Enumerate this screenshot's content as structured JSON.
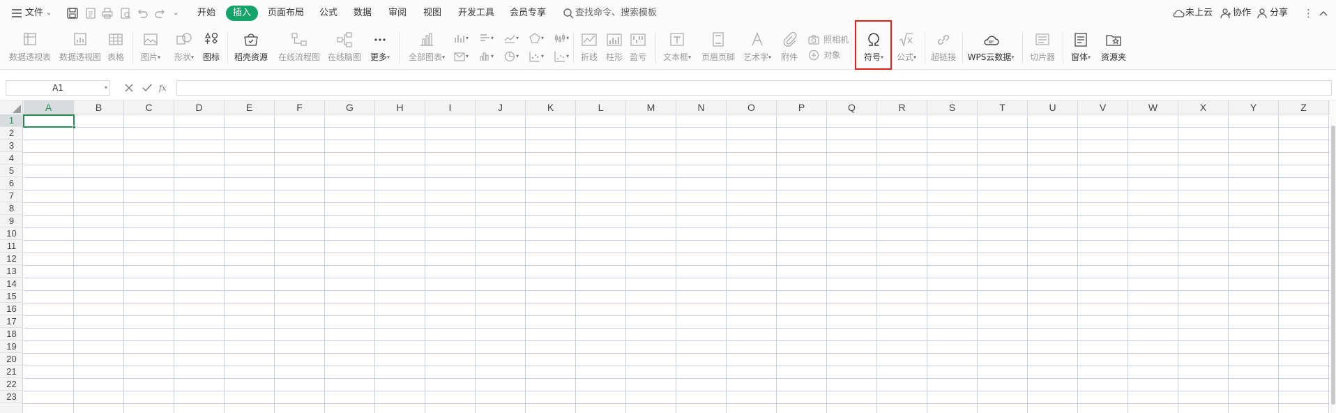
{
  "menubar": {
    "file_label": "文件",
    "tabs": [
      {
        "label": "开始"
      },
      {
        "label": "插入"
      },
      {
        "label": "页面布局"
      },
      {
        "label": "公式"
      },
      {
        "label": "数据"
      },
      {
        "label": "审阅"
      },
      {
        "label": "视图"
      },
      {
        "label": "开发工具"
      },
      {
        "label": "会员专享"
      }
    ],
    "active_tab": "插入",
    "search_placeholder": "查找命令、搜索模板",
    "cloud_label": "未上云",
    "collab_label": "协作",
    "share_label": "分享"
  },
  "ribbon": {
    "pivot_table": "数据透视表",
    "pivot_chart": "数据透视图",
    "table": "表格",
    "picture": "图片",
    "shape": "形状",
    "icon": "图标",
    "daoke": "稻壳资源",
    "flowchart": "在线流程图",
    "mindmap": "在线脑图",
    "more": "更多",
    "all_charts": "全部图表",
    "spark_line": "折线",
    "spark_column": "柱形",
    "spark_winloss": "盈亏",
    "textbox": "文本框",
    "header_footer": "页眉页脚",
    "wordart": "艺术字",
    "attachment": "附件",
    "camera": "照相机",
    "object": "对象",
    "symbol": "符号",
    "formula": "公式",
    "hyperlink": "超链接",
    "wps_cloud_data": "WPS云数据",
    "slicer": "切片器",
    "form": "窗体",
    "resource": "资源夹"
  },
  "formula_bar": {
    "name_box": "A1",
    "formula": ""
  },
  "sheet": {
    "columns": [
      "A",
      "B",
      "C",
      "D",
      "E",
      "F",
      "G",
      "H",
      "I",
      "J",
      "K",
      "L",
      "M",
      "N",
      "O",
      "P",
      "Q",
      "R",
      "S",
      "T",
      "U",
      "V",
      "W",
      "X",
      "Y",
      "Z"
    ],
    "rows": [
      "1",
      "2",
      "3",
      "4",
      "5",
      "6",
      "7",
      "8",
      "9",
      "10",
      "11",
      "12",
      "13",
      "14",
      "15",
      "16",
      "17",
      "18",
      "19",
      "20",
      "21",
      "22",
      "23"
    ],
    "selected_cell": "A1"
  },
  "colors": {
    "accent": "#14a46b",
    "selection": "#1f8d54",
    "highlight_box": "#e0201a",
    "gridline": "#c8cdf0"
  }
}
